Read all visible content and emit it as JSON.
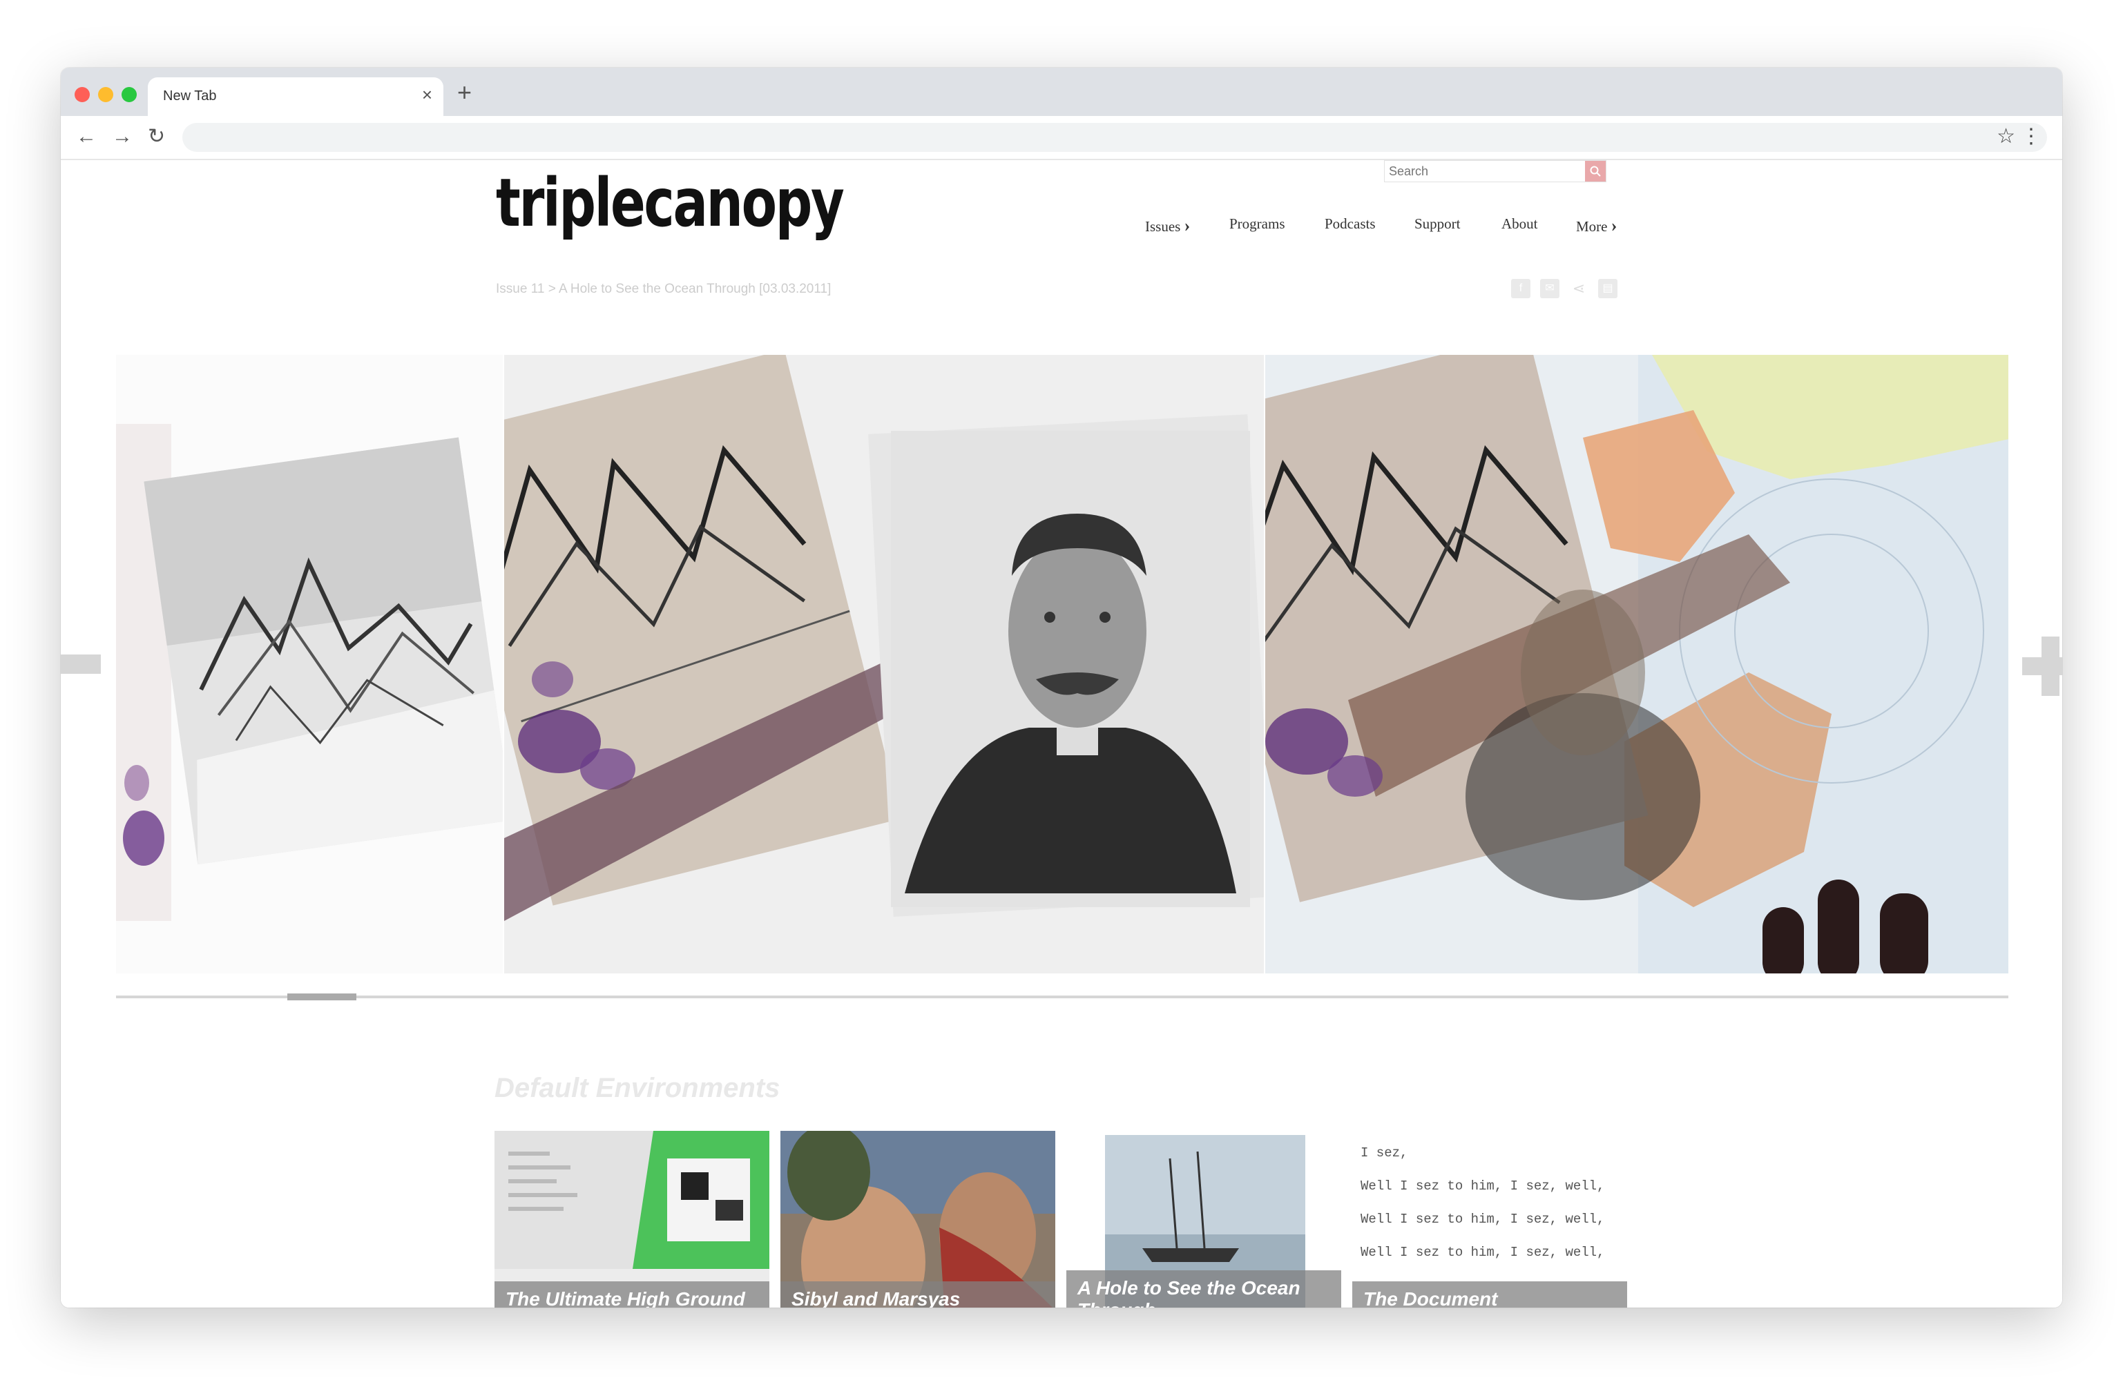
{
  "browser": {
    "tab_title": "New Tab",
    "tab_close": "×",
    "new_tab": "+",
    "back": "←",
    "forward": "→",
    "reload": "↻",
    "url": "",
    "bookmark": "☆",
    "menu": "⋮",
    "traffic_lights": {
      "close": "#fe5f57",
      "minimize": "#febc2e",
      "maximize": "#28c840"
    }
  },
  "site": {
    "logo": "triplecanopy",
    "search_placeholder": "Search",
    "search_icon": "search-icon",
    "nav": [
      {
        "label": "Issues",
        "has_arrow": true,
        "arrow": "›"
      },
      {
        "label": "Programs"
      },
      {
        "label": "Podcasts"
      },
      {
        "label": "Support"
      },
      {
        "label": "About"
      },
      {
        "label": "More",
        "has_arrow": true,
        "arrow": "›"
      }
    ],
    "breadcrumb": "Issue 11 > A Hole to See the Ocean Through [03.03.2011]",
    "share_icons": [
      "facebook-icon",
      "email-icon",
      "share-icon",
      "print-icon"
    ],
    "accent_color": "#e9a8aa"
  },
  "slideshow": {
    "images": [
      "ship-wreck-collage",
      "portrait-collage",
      "arctic-map-collage"
    ]
  },
  "section": {
    "title": "Default Environments",
    "cards": [
      {
        "title": "The Ultimate High Ground"
      },
      {
        "title": "Sibyl and Marsyas"
      },
      {
        "title": "A Hole to See the Ocean Through"
      },
      {
        "title": "The Document"
      }
    ],
    "typewriter_lines": [
      "I sez,",
      "Well I sez to him, I sez, well,",
      "Well I sez to him, I sez, well,",
      "Well I sez to him, I sez, well,"
    ]
  }
}
